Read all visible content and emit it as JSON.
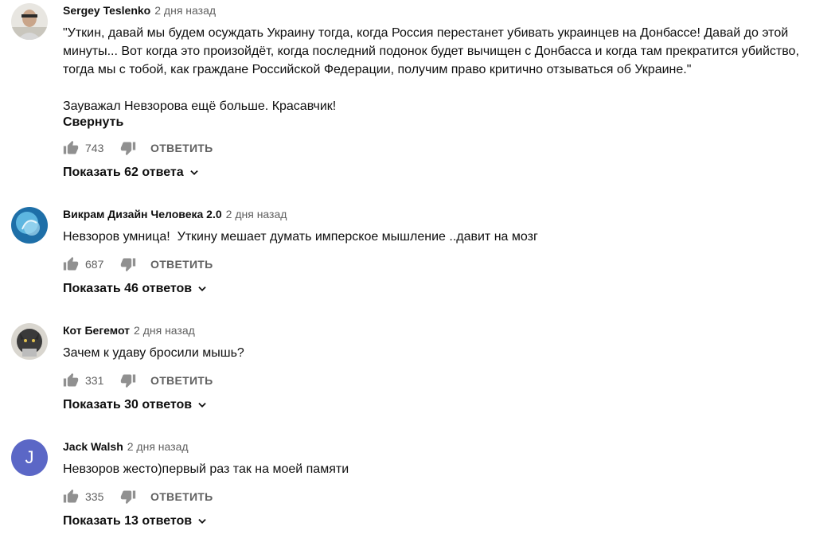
{
  "comments": [
    {
      "author": "Sergey Teslenko",
      "time": "2 дня назад",
      "text": "\"Уткин, давай мы будем осуждать Украину тогда, когда Россия перестанет убивать украинцев на Донбассе! Давай до этой\nминуты... Вот когда это произойдёт, когда последний подонок будет вычищен с Донбасса и когда там прекратится убийство,\nтогда мы с тобой, как граждане Российской Федерации, получим право критично отзываться об Украине.\"\n\nЗауважал Невзорова ещё больше. Красавчик!",
      "collapse_label": "Свернуть",
      "likes": "743",
      "reply_label": "ОТВЕТИТЬ",
      "replies_label": "Показать 62 ответа"
    },
    {
      "author": "Викрам Дизайн Человека 2.0",
      "time": "2 дня назад",
      "text": "Невзоров умница!  Уткину мешает думать имперское мышление ..давит на мозг",
      "likes": "687",
      "reply_label": "ОТВЕТИТЬ",
      "replies_label": "Показать 46 ответов"
    },
    {
      "author": "Кот Бегемот",
      "time": "2 дня назад",
      "text": "Зачем к удаву бросили мышь?",
      "likes": "331",
      "reply_label": "ОТВЕТИТЬ",
      "replies_label": "Показать 30 ответов"
    },
    {
      "author": "Jack Walsh",
      "time": "2 дня назад",
      "avatar_letter": "J",
      "text": "Невзоров жесто)первый раз так на моей памяти",
      "likes": "335",
      "reply_label": "ОТВЕТИТЬ",
      "replies_label": "Показать 13 ответов"
    }
  ],
  "icons": {
    "like": "thumb-up-icon",
    "dislike": "thumb-down-icon",
    "expand": "chevron-down-icon"
  },
  "colors": {
    "secondary_text": "#606060",
    "letter_avatar_bg": "#5b67c6"
  }
}
